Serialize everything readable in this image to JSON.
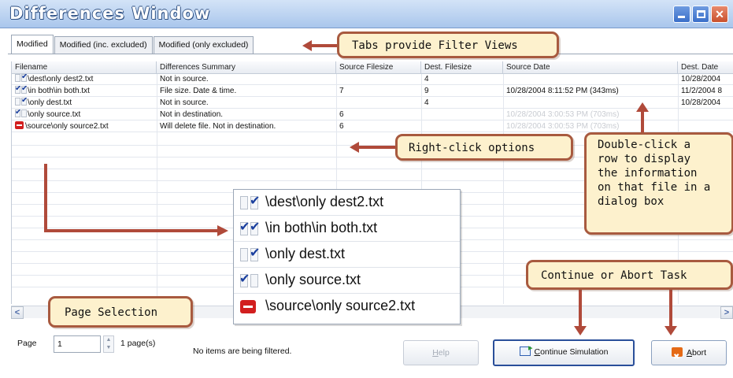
{
  "window": {
    "title": "Differences Window",
    "buttons": [
      "minimize",
      "maximize",
      "close"
    ]
  },
  "tabs": [
    {
      "label": "Modified",
      "active": true
    },
    {
      "label": "Modified (inc. excluded)",
      "active": false
    },
    {
      "label": "Modified (only excluded)",
      "active": false
    }
  ],
  "grid": {
    "columns": [
      "Filename",
      "Differences Summary",
      "Source Filesize",
      "Dest. Filesize",
      "Source Date",
      "Dest. Date"
    ],
    "rows": [
      {
        "checks": [
          false,
          true
        ],
        "delete": false,
        "filename": "\\dest\\only dest2.txt",
        "summary": "Not in source.",
        "source_size": "",
        "dest_size": "4",
        "source_date": "",
        "dest_date": "10/28/2004"
      },
      {
        "checks": [
          true,
          true
        ],
        "delete": false,
        "filename": "\\in both\\in both.txt",
        "summary": "File size. Date & time.",
        "source_size": "7",
        "dest_size": "9",
        "source_date": "10/28/2004 8:11:52 PM (343ms)",
        "dest_date": "11/2/2004 8"
      },
      {
        "checks": [
          false,
          true
        ],
        "delete": false,
        "filename": "\\only dest.txt",
        "summary": "Not in source.",
        "source_size": "",
        "dest_size": "4",
        "source_date": "",
        "dest_date": "10/28/2004"
      },
      {
        "checks": [
          true,
          false
        ],
        "delete": false,
        "filename": "\\only source.txt",
        "summary": "Not in destination.",
        "source_size": "6",
        "dest_size": "",
        "source_date": "10/28/2004 3:00:53 PM (703ms)",
        "dest_date": ""
      },
      {
        "checks": [
          false,
          false
        ],
        "delete": true,
        "filename": "\\source\\only source2.txt",
        "summary": "Will delete file. Not in destination.",
        "source_size": "6",
        "dest_size": "",
        "source_date": "10/28/2004 3:00:53 PM (703ms)",
        "dest_date": ""
      }
    ]
  },
  "scrollbar": {
    "left_icon": "scroll-left-icon",
    "right_icon": "scroll-right-icon"
  },
  "bottom": {
    "page_label": "Page",
    "page_value": "1",
    "page_count": "1 page(s)",
    "filter_status": "No items are being filtered.",
    "help_label": "Help",
    "help_mnemonic": "H",
    "help_rest": "elp",
    "continue_mnemonic": "C",
    "continue_rest": "ontinue Simulation",
    "abort_mnemonic": "A",
    "abort_rest": "bort"
  },
  "inset": {
    "rows": [
      {
        "checks": [
          false,
          true
        ],
        "delete": false,
        "text": "\\dest\\only dest2.txt"
      },
      {
        "checks": [
          true,
          true
        ],
        "delete": false,
        "text": "\\in both\\in both.txt"
      },
      {
        "checks": [
          false,
          true
        ],
        "delete": false,
        "text": "\\only dest.txt"
      },
      {
        "checks": [
          true,
          false
        ],
        "delete": false,
        "text": "\\only source.txt"
      },
      {
        "checks": [
          false,
          false
        ],
        "delete": true,
        "text": "\\source\\only source2.txt"
      }
    ]
  },
  "callouts": {
    "tabs": "Tabs provide Filter Views",
    "right_click": "Right-click options",
    "double_click": [
      "Double-click a",
      "row to display",
      "the information",
      "on that file in a",
      "dialog box"
    ],
    "continue_abort": "Continue or Abort Task",
    "page_selection": "Page Selection"
  },
  "colors": {
    "callout_fill": "#fdf1cd",
    "callout_border": "#a85a3f",
    "arrow": "#b04a3a",
    "delete_red": "#d21f1f",
    "title_blue": "#a9c6ec"
  }
}
